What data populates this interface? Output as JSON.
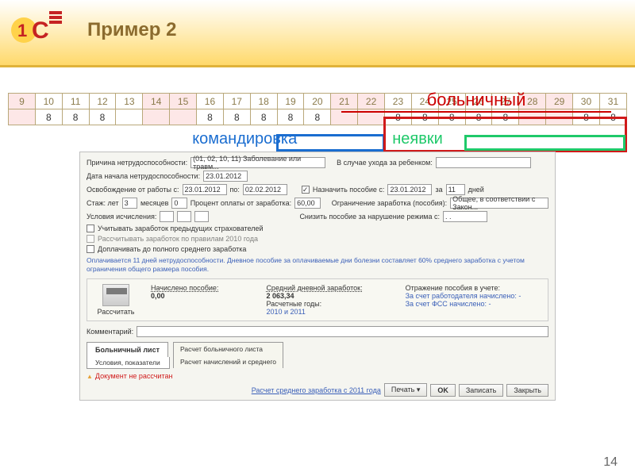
{
  "header": {
    "title": "Пример 2"
  },
  "calendar": {
    "sick_label": "больничный",
    "days": [
      "9",
      "10",
      "11",
      "12",
      "13",
      "14",
      "15",
      "16",
      "17",
      "18",
      "19",
      "20",
      "21",
      "22",
      "23",
      "24",
      "25",
      "26",
      "27",
      "28",
      "29",
      "30",
      "31"
    ],
    "values": [
      "",
      "8",
      "8",
      "8",
      "",
      "",
      "",
      "8",
      "8",
      "8",
      "8",
      "8",
      "",
      "",
      "8",
      "8",
      "8",
      "8",
      "8",
      "",
      "",
      "8",
      "8"
    ],
    "pink_indices": [
      0,
      5,
      6,
      12,
      13,
      19,
      20
    ],
    "legend_trip": "командировка",
    "legend_absence": "неявки"
  },
  "form": {
    "reason_lab": "Причина нетрудоспособности:",
    "reason_val": "(01, 02, 10, 11) Заболевание или травм...",
    "child_lab": "В случае ухода за ребенком:",
    "start_lab": "Дата начала нетрудоспособности:",
    "start_val": "23.01.2012",
    "release_lab": "Освобождение от работы с:",
    "release_from": "23.01.2012",
    "to_lab": "по:",
    "release_to": "02.02.2012",
    "assign_lab": "Назначить пособие с:",
    "assign_from": "23.01.2012",
    "for_lab": "за",
    "days_count": "11",
    "days_word": "дней",
    "exp_lab": "Стаж: лет",
    "exp_y": "3",
    "exp_m_lab": "месяцев",
    "exp_m": "0",
    "pct_lab": "Процент оплаты от заработка:",
    "pct": "60,00",
    "limit_lab": "Ограничение заработка (пособия):",
    "limit_val": "Общее, в соответствии с Закон...",
    "calc_cond_lab": "Условия исчисления:",
    "reduce_lab": "Снизить пособие за нарушение режима с:",
    "cb1": "Учитывать заработок предыдущих страхователей",
    "cb2": "Рассчитывать заработок по правилам 2010 года",
    "cb3": "Доплачивать до полного среднего заработка",
    "blue_note": "Оплачивается 11 дней нетрудоспособности. Дневное пособие за оплачиваемые дни болезни составляет 60% среднего заработка с учетом ограничения общего размера пособия.",
    "calc_btn": "Рассчитать",
    "accr_lab": "Начислено пособие:",
    "accr_val": "0,00",
    "avg_lab": "Средний дневной заработок:",
    "avg_val": "2 063,34",
    "years_lab": "Расчетные годы:",
    "years_val": "2010 и 2011",
    "refl_lab": "Отражение пособия в учете:",
    "refl1": "За счет работодателя начислено: -",
    "refl2": "За счет ФСС начислено: -",
    "comment_lab": "Комментарий:",
    "tab1": "Больничный лист",
    "tab1s": "Условия, показатели",
    "tab2a": "Расчет больничного листа",
    "tab2b": "Расчет начислений и среднего",
    "status": "Документ не рассчитан",
    "foot_link": "Расчет среднего заработка с 2011 года",
    "btn_print": "Печать ▾",
    "btn_ok": "OK",
    "btn_save": "Записать",
    "btn_close": "Закрыть"
  },
  "page_num": "14"
}
